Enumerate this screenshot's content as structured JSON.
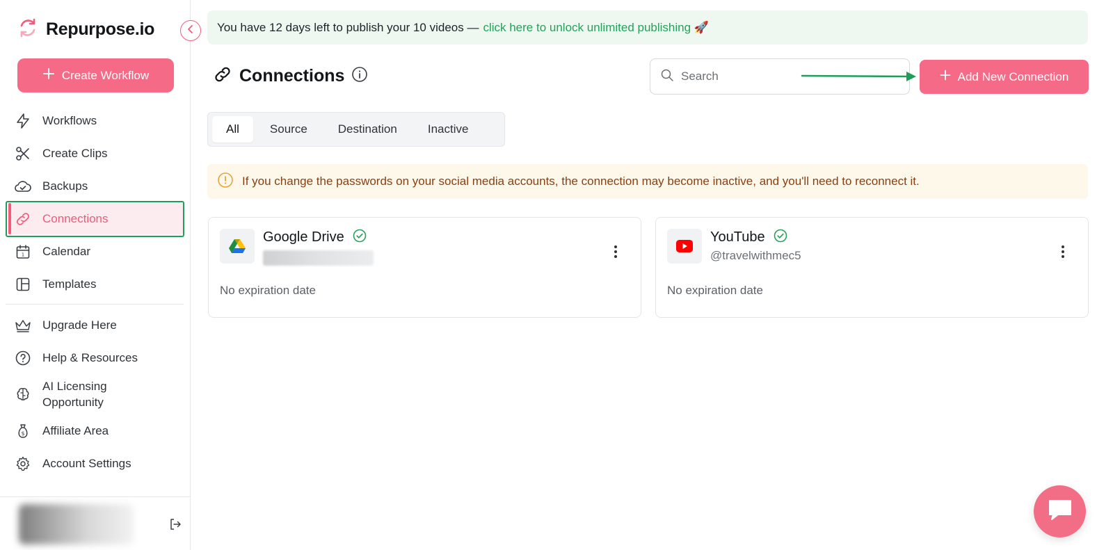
{
  "app": {
    "name": "Repurpose.io"
  },
  "sidebar": {
    "create_label": "Create Workflow",
    "items": [
      {
        "label": "Workflows",
        "icon": "lightning-icon"
      },
      {
        "label": "Create Clips",
        "icon": "scissors-icon"
      },
      {
        "label": "Backups",
        "icon": "cloud-icon"
      },
      {
        "label": "Connections",
        "icon": "link-icon",
        "active": true
      },
      {
        "label": "Calendar",
        "icon": "calendar-icon"
      },
      {
        "label": "Templates",
        "icon": "layout-icon"
      }
    ],
    "secondary_items": [
      {
        "label": "Upgrade Here",
        "icon": "crown-icon"
      },
      {
        "label": "Help & Resources",
        "icon": "question-icon"
      },
      {
        "label": "AI Licensing Opportunity",
        "icon": "brain-icon"
      },
      {
        "label": "Affiliate Area",
        "icon": "money-bag-icon"
      },
      {
        "label": "Account Settings",
        "icon": "gear-icon"
      }
    ]
  },
  "banner": {
    "text": "You have 12 days left to publish your 10 videos —",
    "link": "click here to unlock unlimited publishing 🚀"
  },
  "page": {
    "title": "Connections",
    "search_placeholder": "Search",
    "add_label": "Add New Connection"
  },
  "tabs": [
    "All",
    "Source",
    "Destination",
    "Inactive"
  ],
  "notice": "If you change the passwords on your social media accounts, the connection may become inactive, and you'll need to reconnect it.",
  "connections": [
    {
      "name": "Google Drive",
      "handle": "",
      "expiry": "No expiration date",
      "verified": true
    },
    {
      "name": "YouTube",
      "handle": "@travelwithmec5",
      "expiry": "No expiration date",
      "verified": true
    }
  ],
  "colors": {
    "accent": "#f56a86",
    "success": "#27a05a",
    "notice_bg": "#fdf8ea",
    "banner_bg": "#eef8f0"
  }
}
